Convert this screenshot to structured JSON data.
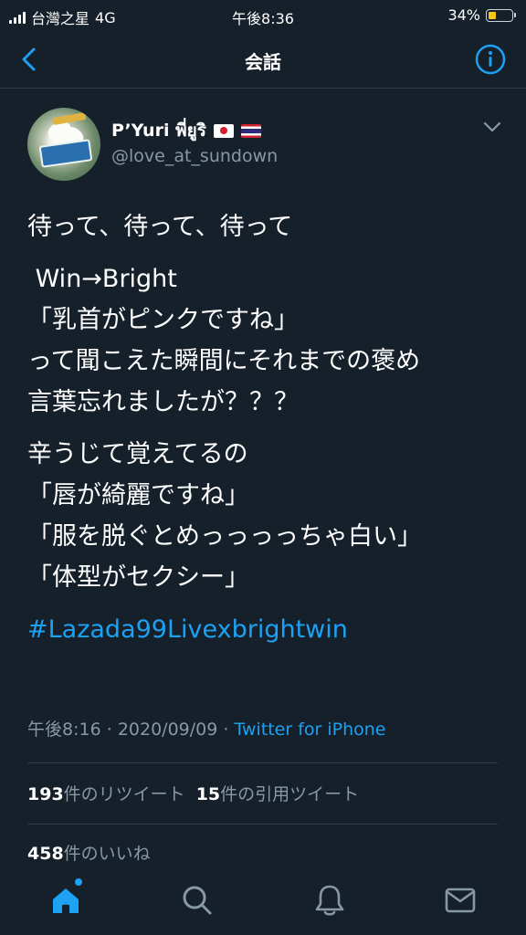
{
  "status_bar": {
    "carrier": "台灣之星",
    "network": "4G",
    "time": "午後8:36",
    "battery": "34%",
    "battery_level": 0.34,
    "battery_color": "#f5c518"
  },
  "nav": {
    "title": "会話",
    "back_icon": "chevron-left-icon",
    "info_icon": "info-icon"
  },
  "tweet": {
    "author_name": "P’Yuri พี่ยูริ",
    "author_handle": "@love_at_sundown",
    "flags": [
      "japan-flag",
      "thailand-flag"
    ],
    "lines": [
      "待って、待って、待って",
      " Win→Bright\n「乳首がピンクですね」\nって聞こえた瞬間にそれまでの褒め\n言葉忘れましたが？？？",
      "辛うじて覚えてるの\n「唇が綺麗ですね」\n「服を脱ぐとめっっっっちゃ白い」\n「体型がセクシー」"
    ],
    "hashtag": "#Lazada99Livexbrightwin",
    "time": "午後8:16",
    "date": "2020/09/09",
    "source": "Twitter for iPhone"
  },
  "stats": {
    "retweets_count": "193",
    "retweets_label": "件のリツイート",
    "quotes_count": "15",
    "quotes_label": "件の引用ツイート",
    "likes_count": "458",
    "likes_label": "件のいいね"
  },
  "tab_bar": {
    "items": [
      "home-icon",
      "search-icon",
      "notifications-icon",
      "messages-icon"
    ]
  },
  "colors": {
    "background": "#15202b",
    "accent": "#1da1f2",
    "muted_text": "#8899a6",
    "divider": "#2f3b47"
  }
}
